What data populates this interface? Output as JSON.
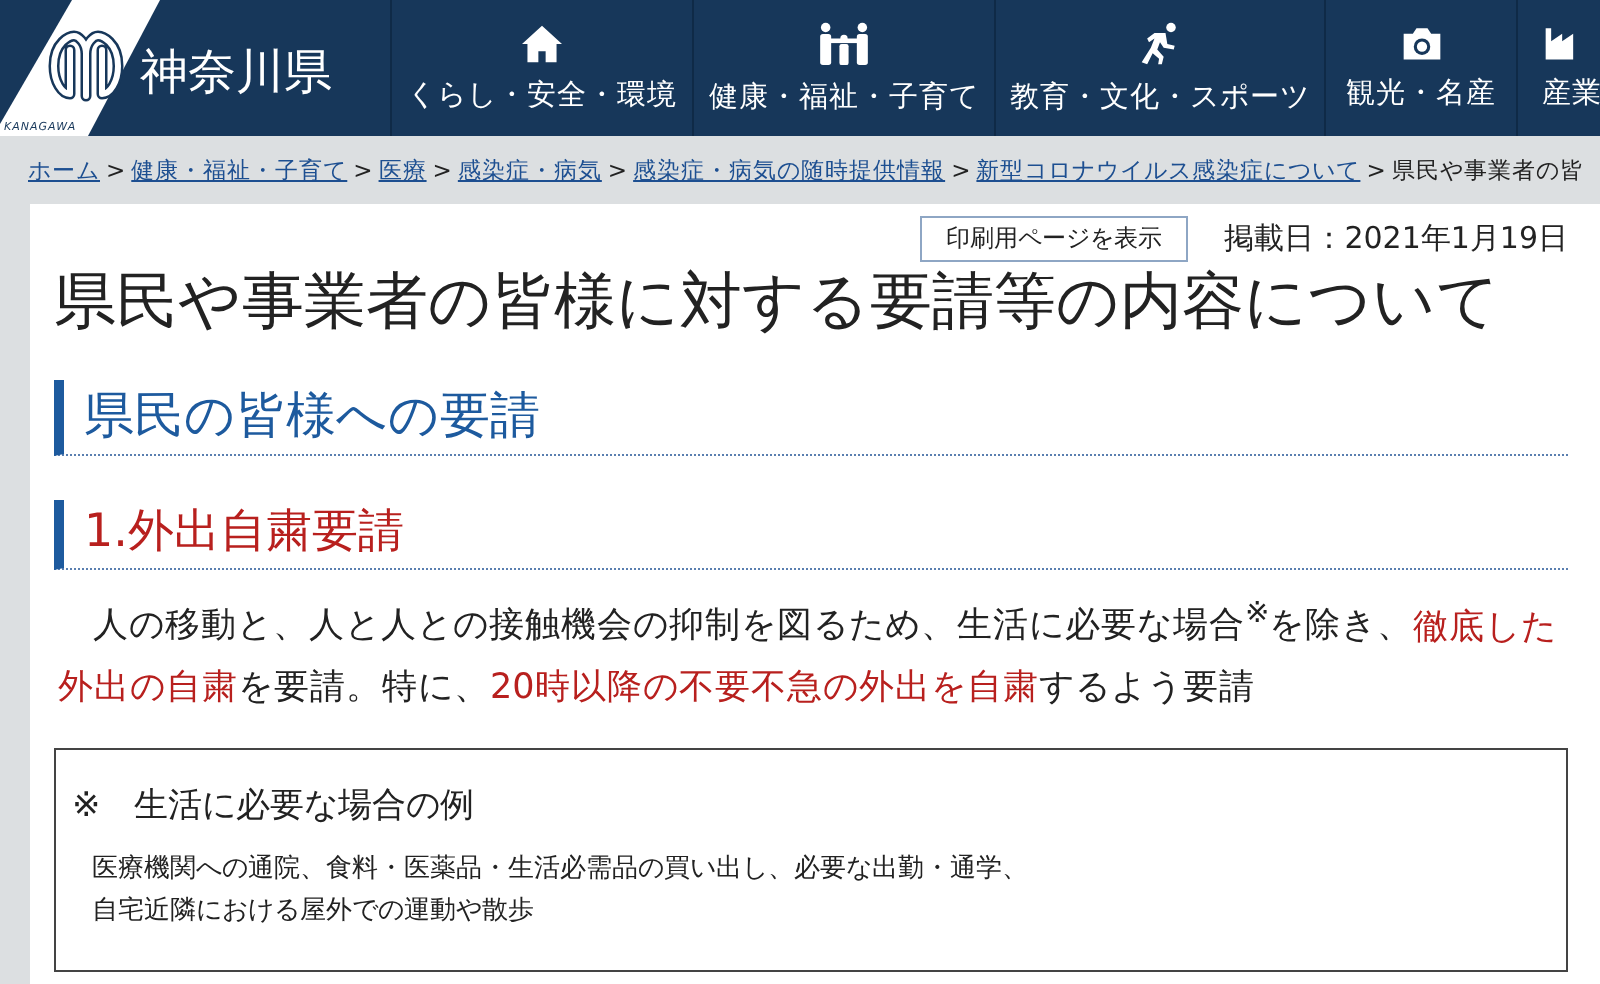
{
  "header": {
    "logo_caption": "KANAGAWA",
    "site_name": "神奈川県",
    "nav": [
      {
        "label": "くらし・安全・環境"
      },
      {
        "label": "健康・福祉・子育て"
      },
      {
        "label": "教育・文化・スポーツ"
      },
      {
        "label": "観光・名産"
      },
      {
        "label": "産業"
      }
    ]
  },
  "breadcrumb": [
    {
      "label": "ホーム",
      "kind": "link"
    },
    {
      "separator": ">",
      "label": "健康・福祉・子育て",
      "kind": "link"
    },
    {
      "separator": ">",
      "label": "医療",
      "kind": "link"
    },
    {
      "separator": ">",
      "label": "感染症・病気",
      "kind": "link"
    },
    {
      "separator": ">",
      "label": "感染症・病気の随時提供情報",
      "kind": "link"
    },
    {
      "separator": ">",
      "label": "新型コロナウイルス感染症について",
      "kind": "link"
    },
    {
      "separator": ">",
      "label": "県民や事業者の皆",
      "kind": "current"
    }
  ],
  "print_button": "印刷用ページを表示",
  "posted_date": "掲載日：2021年1月19日",
  "title": "県民や事業者の皆様に対する要請等の内容について",
  "section_heading": "県民の皆様への要請",
  "subsection_heading": "1.外出自粛要請",
  "paragraph": [
    {
      "text": "人の移動と、人と人との接触機会の抑制を図るため、生活に必要な場合$^{※}$を除き、",
      "emphasis": false
    },
    {
      "text": "徹底した外出の自粛",
      "emphasis": true
    },
    {
      "text": "を要請。特に、",
      "emphasis": false
    },
    {
      "text": "20時以降の不要不急の外出を自粛",
      "emphasis": true
    },
    {
      "text": "するよう要請",
      "emphasis": false
    }
  ],
  "note_box": {
    "heading": "※　生活に必要な場合の例",
    "lines": [
      "医療機関への通院、食料・医薬品・生活必需品の買い出し、必要な出勤・通学、",
      "自宅近隣における屋外での運動や散歩"
    ]
  }
}
